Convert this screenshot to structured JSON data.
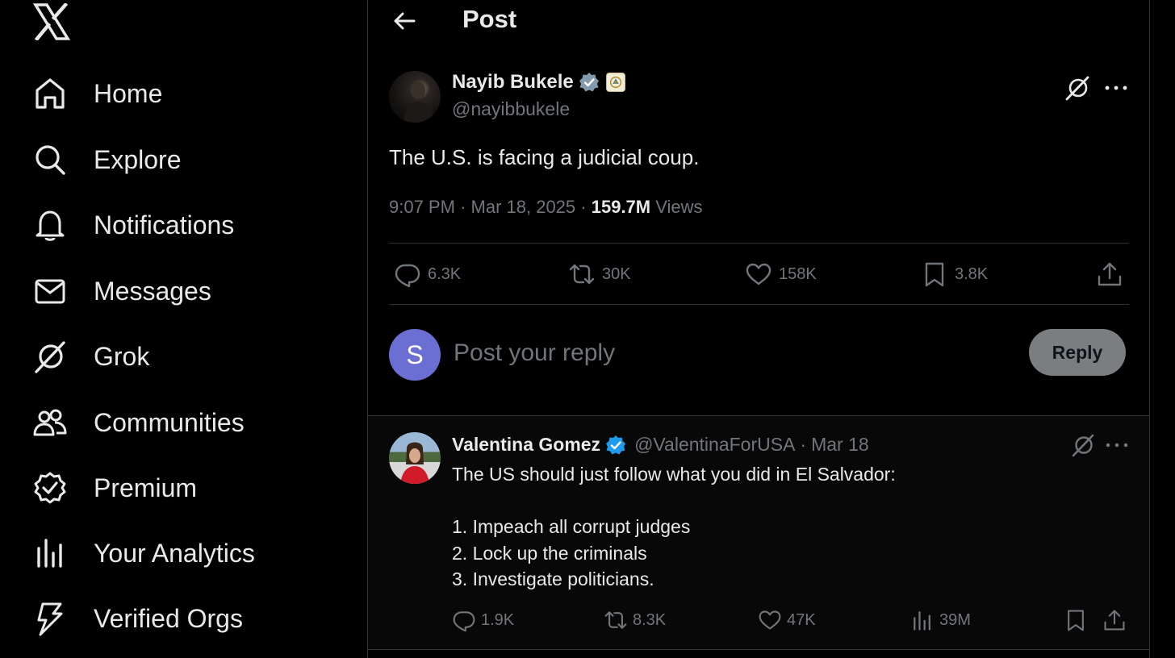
{
  "sidebar": {
    "logo": "x-logo",
    "items": [
      {
        "label": "Home",
        "icon": "home-icon"
      },
      {
        "label": "Explore",
        "icon": "search-icon"
      },
      {
        "label": "Notifications",
        "icon": "bell-icon"
      },
      {
        "label": "Messages",
        "icon": "envelope-icon"
      },
      {
        "label": "Grok",
        "icon": "grok-icon"
      },
      {
        "label": "Communities",
        "icon": "people-icon"
      },
      {
        "label": "Premium",
        "icon": "premium-badge-icon"
      },
      {
        "label": "Your Analytics",
        "icon": "bar-chart-icon"
      },
      {
        "label": "Verified Orgs",
        "icon": "lightning-icon"
      }
    ]
  },
  "header": {
    "title": "Post"
  },
  "post": {
    "author_name": "Nayib Bukele",
    "author_handle": "@nayibbukele",
    "text": "The U.S. is facing a judicial coup.",
    "time": "9:07 PM",
    "separator": "·",
    "date": "Mar 18, 2025",
    "views_count": "159.7M",
    "views_label": "Views",
    "stats": {
      "replies": "6.3K",
      "reposts": "30K",
      "likes": "158K",
      "bookmarks": "3.8K"
    }
  },
  "reply_box": {
    "avatar_letter": "S",
    "placeholder": "Post your reply",
    "button_label": "Reply"
  },
  "reply": {
    "author_name": "Valentina Gomez",
    "author_handle": "@ValentinaForUSA",
    "separator": "·",
    "date": "Mar 18",
    "lines": [
      "The US should just follow what you did in El Salvador:",
      "",
      "1. Impeach all corrupt judges",
      "2. Lock up the criminals",
      "3. Investigate politicians."
    ],
    "stats": {
      "replies": "1.9K",
      "reposts": "8.3K",
      "likes": "47K",
      "views": "39M"
    }
  },
  "colors": {
    "background": "#000000",
    "text": "#e7e9ea",
    "muted": "#71767b",
    "border": "#2f3336",
    "verified_blue": "#1d9bf0",
    "verified_gray": "#829aab",
    "reply_avatar": "#6b6fd4"
  }
}
